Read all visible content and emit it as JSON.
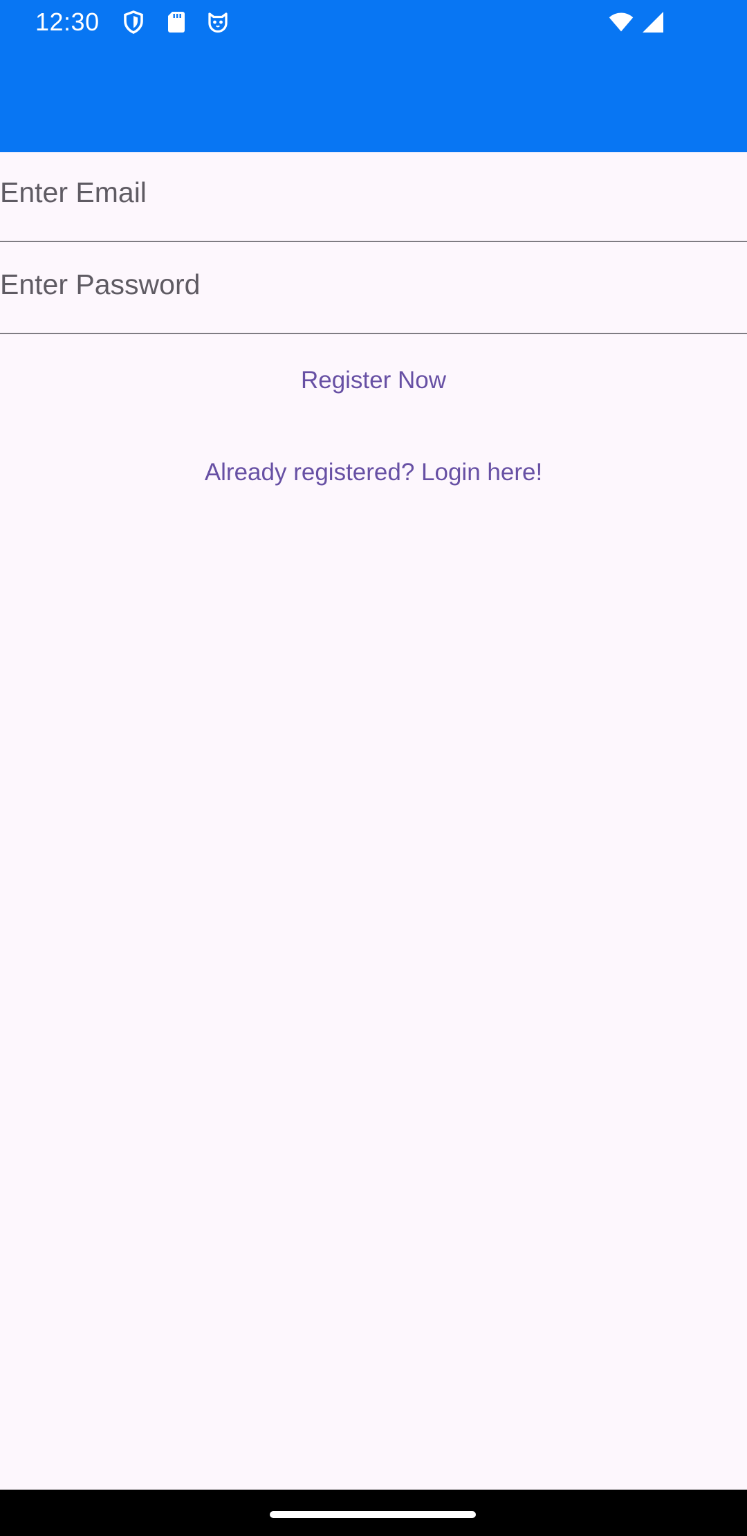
{
  "status_bar": {
    "time": "12:30",
    "icons": [
      "shield-icon",
      "sd-card-icon",
      "cat-face-icon",
      "wifi-icon",
      "cellular-signal-icon"
    ]
  },
  "form": {
    "email_placeholder": "Enter Email",
    "email_value": "",
    "password_placeholder": "Enter Password",
    "password_value": ""
  },
  "actions": {
    "register_label": "Register Now",
    "login_link_label": "Already registered? Login here!"
  },
  "colors": {
    "app_bar": "#0876f3",
    "background": "#fdf7fd",
    "accent_text": "#6750a4",
    "nav_bar": "#000000"
  }
}
